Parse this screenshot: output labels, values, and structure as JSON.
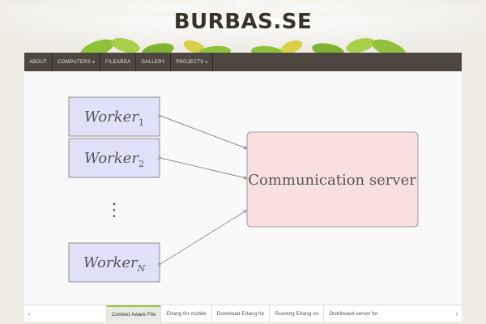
{
  "site": {
    "title": "BURBAS.SE"
  },
  "nav": {
    "items": [
      {
        "label": "ABOUT",
        "has_caret": false
      },
      {
        "label": "COMPUTERS",
        "has_caret": true
      },
      {
        "label": "FILEAREA",
        "has_caret": false
      },
      {
        "label": "GALLERY",
        "has_caret": false
      },
      {
        "label": "PROJECTS",
        "has_caret": true
      }
    ],
    "caret_glyph": "▾"
  },
  "diagram": {
    "workers": [
      {
        "name": "Worker",
        "sub": "1"
      },
      {
        "name": "Worker",
        "sub": "2"
      },
      {
        "name": "Worker",
        "sub": "N"
      }
    ],
    "ellipsis": "⋮",
    "server_label": "Communication server",
    "colors": {
      "worker_fill": "#e0e0f8",
      "worker_stroke": "#777777",
      "server_fill": "#f8e0e0",
      "server_stroke": "#888888",
      "arrow": "#666666"
    }
  },
  "slider": {
    "prev_icon": "‹",
    "next_icon": "›",
    "tabs": [
      {
        "label": "Context Aware File",
        "active": true
      },
      {
        "label": "Erlang for mobile",
        "active": false
      },
      {
        "label": "Download Erlang for",
        "active": false
      },
      {
        "label": "Running Erlang on",
        "active": false
      },
      {
        "label": "Distributed server for",
        "active": false
      }
    ]
  },
  "theme": {
    "accent": "#9bc23c",
    "nav_bg": "#4e4640"
  }
}
